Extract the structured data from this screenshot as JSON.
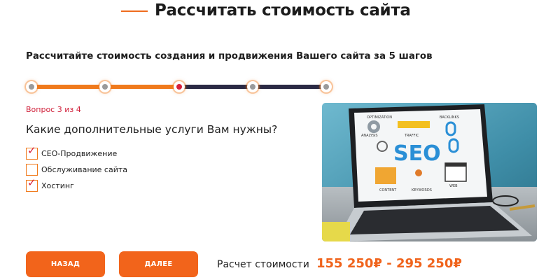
{
  "header": {
    "title": "Рассчитать стоимость сайта"
  },
  "calculator": {
    "subtitle": "Рассчитайте стоимость создания и продвижения Вашего сайта за 5 шагов",
    "progress": {
      "current_step": 3,
      "total_steps": 5
    },
    "question_number": "Вопрос 3 из 4",
    "question": "Какие дополнительные услуги Вам нужны?",
    "options": [
      {
        "label": "СЕО-Продвижение",
        "checked": true
      },
      {
        "label": "Обслуживание сайта",
        "checked": false
      },
      {
        "label": "Хостинг",
        "checked": true
      }
    ],
    "check_mark": "✓"
  },
  "image": {
    "seo_text": "SEO",
    "labels": [
      "OPTIMIZATION",
      "BACKLINKS",
      "ANALYSIS",
      "TRAFFIC",
      "CONTENT",
      "KEYWORDS",
      "WEB"
    ]
  },
  "buttons": {
    "back": "НАЗАД",
    "next": "ДАЛЕЕ"
  },
  "price": {
    "label": "Расчет стоимости",
    "value": "155 250₽ - 295 250₽"
  },
  "colors": {
    "accent": "#f2641b",
    "active_step": "#d81f3a",
    "track_pending": "#2b2a44"
  }
}
